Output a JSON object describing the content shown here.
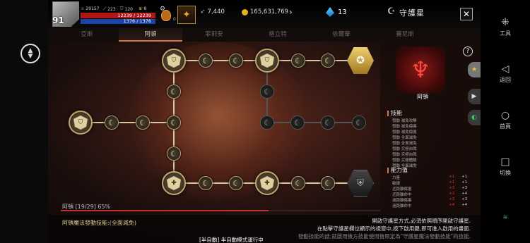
{
  "hud": {
    "level": "91",
    "stat1": "29157",
    "stat2": "223",
    "stat3": "120",
    "stat4": "8",
    "hp": "12239 / 12239",
    "mp": "1376 / 1376",
    "potion_count": "0",
    "feather": "7,440",
    "gold": "165,631,769",
    "gem": "13"
  },
  "window": {
    "title": "守護星",
    "close": "✕"
  },
  "tabs": [
    "亞斯",
    "阿頓",
    "菲莉安",
    "格立特",
    "依爾華",
    "賽尼斯"
  ],
  "progress": {
    "label": "阿頓 [19/29] 65%",
    "fraction": 0.65
  },
  "bottom": {
    "skill_line": "阿頓魔法發動技能:(全面減免)",
    "notice_1": "開啟守護星方式,必須依照順序開啟守護星.",
    "notice_2": "在點擊守護星欄位顯示的視窗中,按下啟用鍵,即可進入啟用的畫面.",
    "notice_3": "發動技能的話,就啟用後方技能使用後限定為\"守護星魔法發動技能\"的技能.",
    "auto": "[半自動] 半自動模式運行中"
  },
  "panel": {
    "name": "阿頓",
    "skills_title": "技能",
    "skills": [
      "發動 減免攻擊",
      "發動 減免傷害",
      "發動 減免傷害",
      "發動 全面減免",
      "發動 全面減免",
      "發動 究極自我",
      "發動 究極自我",
      "發動 究極體驗",
      "發動 全面減免"
    ],
    "ability_title": "能力值",
    "abilities": [
      {
        "name": "力量",
        "cur": "+1",
        "next": "+1"
      },
      {
        "name": "敏捷",
        "cur": "+1",
        "next": "+1"
      },
      {
        "name": "近距離傷害",
        "cur": "+3",
        "next": "+3"
      },
      {
        "name": "近距離命中",
        "cur": "+3",
        "next": "+4"
      },
      {
        "name": "遠距離傷害",
        "cur": "+3",
        "next": "+3"
      },
      {
        "name": "遠距離命中",
        "cur": "+4",
        "next": "+4"
      }
    ]
  },
  "system": {
    "tools": "工具",
    "back": "返回",
    "home": "首頁",
    "switch": "切換"
  },
  "icons": {
    "crest": "flame-crest-icon",
    "moon": "crescent-moon-icon",
    "star": "star-icon"
  },
  "colors": {
    "accent": "#d07848",
    "hp": "#b01818",
    "mp": "#1c44a8",
    "gold": "#e4b020"
  }
}
